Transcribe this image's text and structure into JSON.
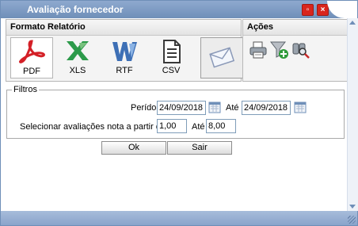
{
  "window": {
    "title": "Avaliação fornecedor"
  },
  "formats": {
    "header": "Formato Relatório",
    "items": [
      {
        "label": "PDF",
        "icon": "pdf-icon"
      },
      {
        "label": "XLS",
        "icon": "excel-icon"
      },
      {
        "label": "RTF",
        "icon": "word-icon"
      },
      {
        "label": "CSV",
        "icon": "document-icon"
      },
      {
        "label": "",
        "icon": "email-icon"
      }
    ]
  },
  "actions": {
    "header": "Ações",
    "items": [
      "printer-icon",
      "filter-add-icon",
      "search-binoculars-icon"
    ]
  },
  "filters": {
    "legend": "Filtros",
    "period_label": "Perído:",
    "period_from": "24/09/2018",
    "period_to_label": "Até",
    "period_to": "24/09/2018",
    "rating_label": "Selecionar avaliações nota a partir de:",
    "rating_from": "1,00",
    "rating_to_label": "Até",
    "rating_to": "8,00"
  },
  "buttons": {
    "ok": "Ok",
    "exit": "Sair"
  },
  "colors": {
    "titlebar": "#6f8fb8",
    "close": "#d9251d",
    "pdf": "#d42027",
    "xls": "#2c9a4a",
    "rtf": "#3d6fb5"
  }
}
